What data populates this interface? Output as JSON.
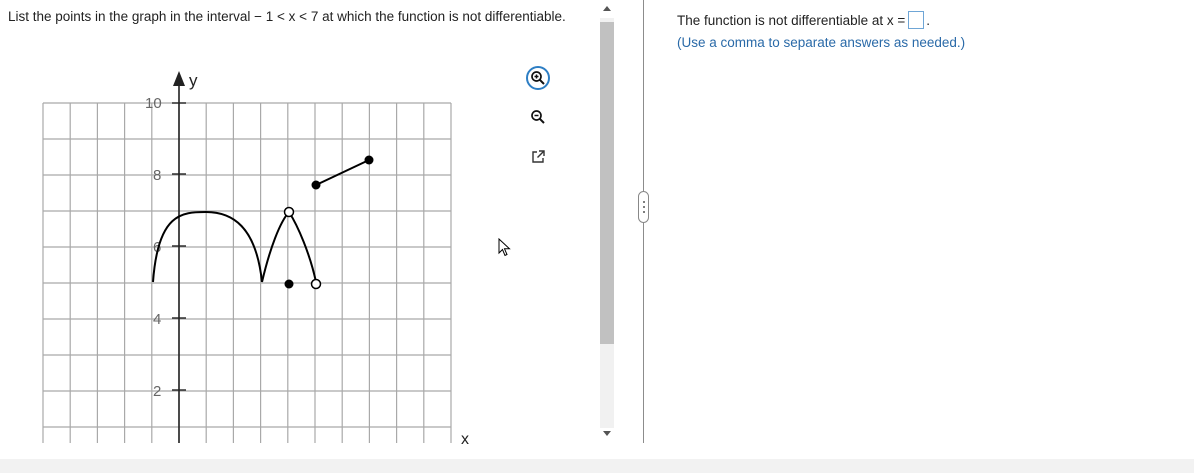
{
  "question": {
    "text_before": "List the points in the graph in the interval ",
    "interval": "− 1 < x < 7",
    "text_after": " at which the function is not differentiable."
  },
  "graph": {
    "x_axis_label": "x",
    "y_axis_label": "y",
    "y_tick_labels": [
      "10",
      "8",
      "6",
      "4",
      "2"
    ],
    "colors": {
      "grid": "#a9a9a9",
      "axis": "#222222",
      "curve": "#000000"
    }
  },
  "toolbar": {
    "zoom_in_icon": "zoom-in-icon",
    "zoom_out_icon": "zoom-out-icon",
    "popout_icon": "external-link-icon",
    "accent_color": "#2d7ec4"
  },
  "answer": {
    "prompt": "The function is not differentiable at x =",
    "value": "",
    "period": ".",
    "hint": "(Use a comma to separate answers as needed.)"
  }
}
